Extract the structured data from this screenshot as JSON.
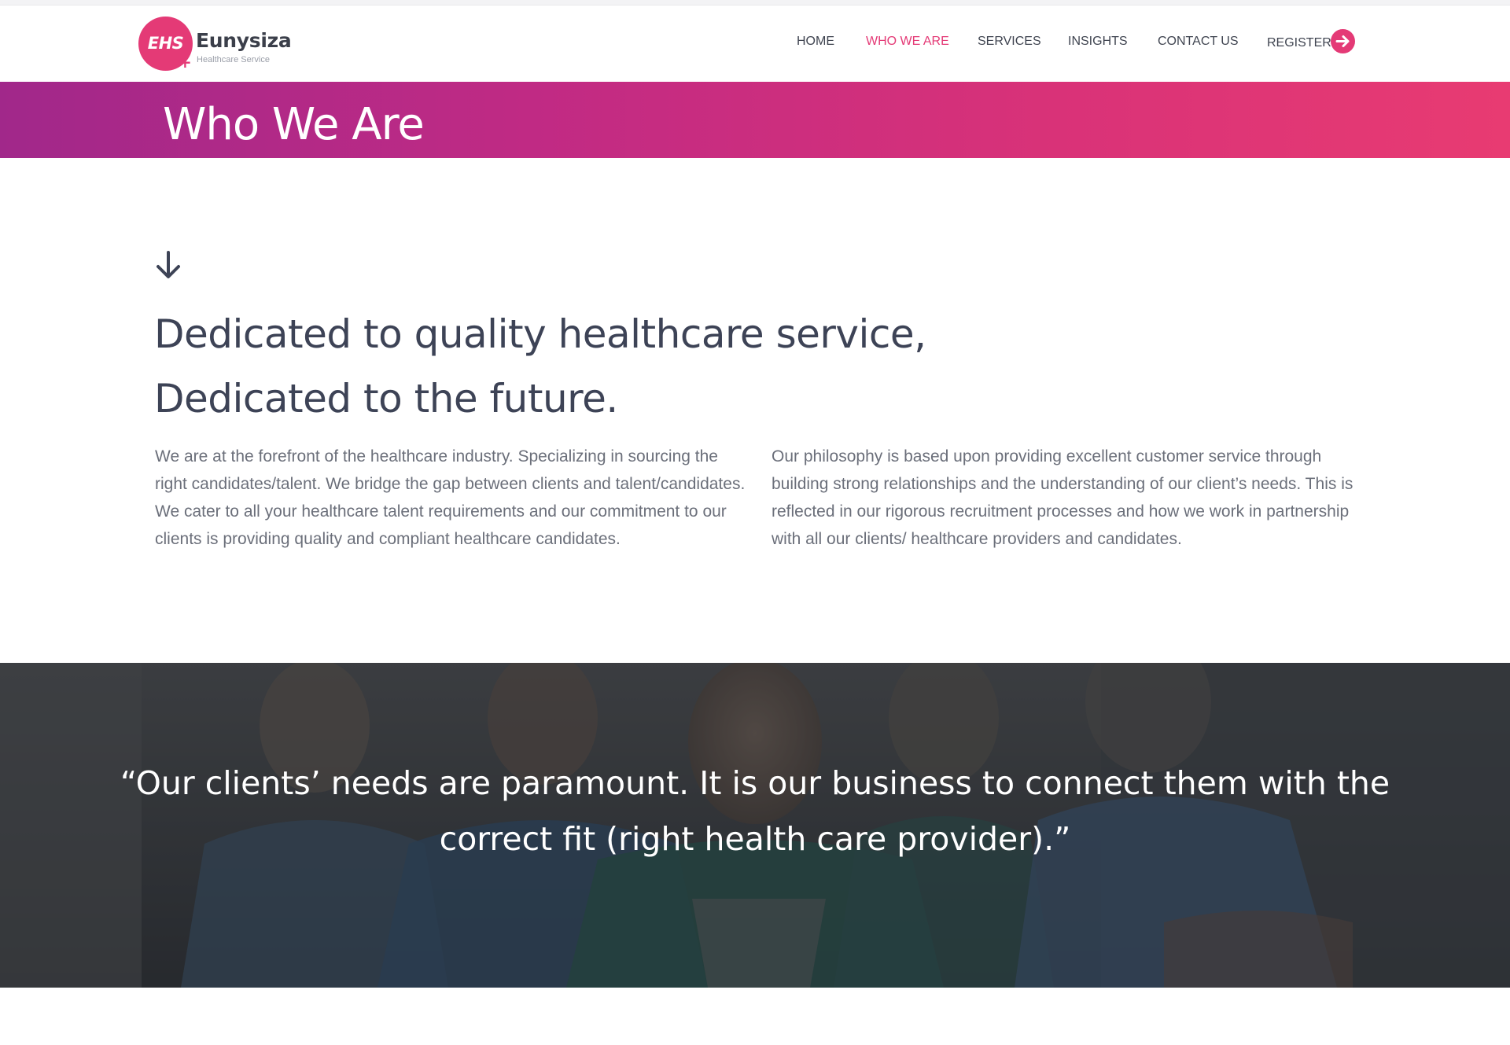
{
  "brand": {
    "logo_mark": "EHS",
    "name": "Eunysiza",
    "tagline": "Healthcare Service",
    "accent_color": "#e43a76"
  },
  "nav": {
    "items": [
      {
        "label": "HOME",
        "active": false
      },
      {
        "label": "WHO WE ARE",
        "active": true
      },
      {
        "label": "SERVICES",
        "active": false
      },
      {
        "label": "INSIGHTS",
        "active": false
      },
      {
        "label": "CONTACT US",
        "active": false
      }
    ],
    "register_label": "REGISTER",
    "register_icon": "arrow-right-circle-icon"
  },
  "banner": {
    "title": "Who We Are"
  },
  "intro": {
    "scroll_icon": "arrow-down-icon",
    "headline_line1": "Dedicated to quality healthcare service,",
    "headline_line2": "Dedicated to the future.",
    "left_paragraph": "We are at the forefront of the healthcare industry. Specializing in sourcing the right candidates/talent. We bridge the gap between clients and talent/candidates. We cater to all your healthcare talent requirements and our commitment to our clients is providing quality and compliant healthcare candidates.",
    "right_paragraph": "Our philosophy is based upon providing excellent customer service through building strong relationships and the understanding of our client’s needs. This is reflected in our rigorous recruitment processes and how we work in partnership with all our clients/ healthcare providers and candidates."
  },
  "quote": {
    "text": "“Our clients’ needs are paramount. It is our business to connect them with the correct fit (right health care provider).”"
  }
}
